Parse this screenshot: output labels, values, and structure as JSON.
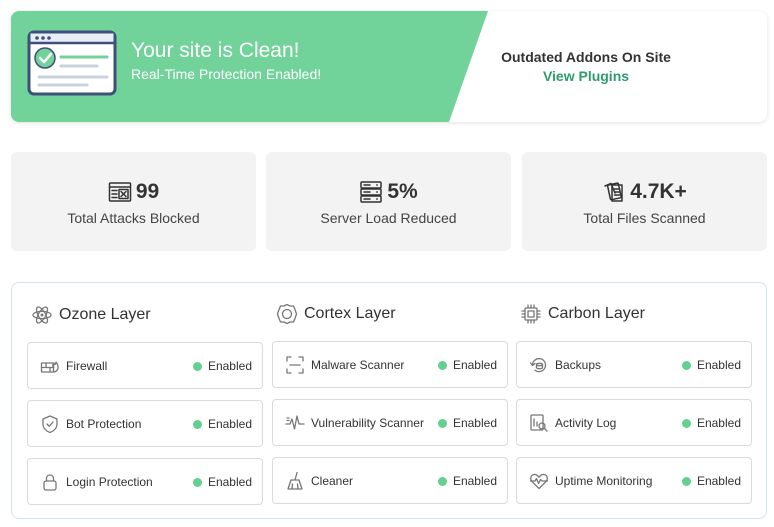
{
  "banner": {
    "title": "Your site is Clean!",
    "subtitle": "Real-Time Protection Enabled!",
    "outdated_label": "Outdated Addons On Site",
    "view_plugins": "View Plugins",
    "green_color": "#71d29a",
    "link_color": "#2e9c6c"
  },
  "stats": [
    {
      "icon": "firewall-window-icon",
      "value": "99",
      "label": "Total Attacks Blocked"
    },
    {
      "icon": "server-icon",
      "value": "5%",
      "label": "Server Load Reduced"
    },
    {
      "icon": "files-stack-icon",
      "value": "4.7K+",
      "label": "Total Files Scanned"
    }
  ],
  "layers": [
    {
      "title": "Ozone Layer",
      "icon": "atom-icon",
      "items": [
        {
          "label": "Firewall",
          "status": "Enabled",
          "icon": "firewall-icon"
        },
        {
          "label": "Bot Protection",
          "status": "Enabled",
          "icon": "shield-icon"
        },
        {
          "label": "Login Protection",
          "status": "Enabled",
          "icon": "lock-icon"
        }
      ]
    },
    {
      "title": "Cortex Layer",
      "icon": "cortex-icon",
      "items": [
        {
          "label": "Malware Scanner",
          "status": "Enabled",
          "icon": "scan-icon"
        },
        {
          "label": "Vulnerability Scanner",
          "status": "Enabled",
          "icon": "pulse-icon"
        },
        {
          "label": "Cleaner",
          "status": "Enabled",
          "icon": "broom-icon"
        }
      ]
    },
    {
      "title": "Carbon Layer",
      "icon": "chip-icon",
      "items": [
        {
          "label": "Backups",
          "status": "Enabled",
          "icon": "backup-icon"
        },
        {
          "label": "Activity Log",
          "status": "Enabled",
          "icon": "activity-log-icon"
        },
        {
          "label": "Uptime Monitoring",
          "status": "Enabled",
          "icon": "heart-pulse-icon"
        }
      ]
    }
  ],
  "status_dot_color": "#62d08f"
}
